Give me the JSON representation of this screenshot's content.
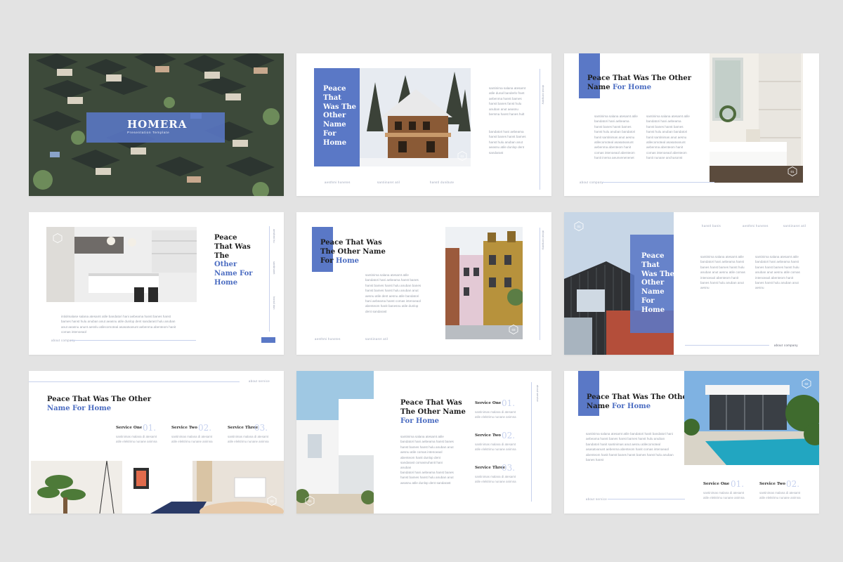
{
  "colors": {
    "accent": "#5a78c6",
    "accent_text": "#4b6cc1",
    "background": "#e3e3e3",
    "slide": "#ffffff"
  },
  "s1": {
    "brand": "HOMERA",
    "subtitle": "Presentation Template"
  },
  "s2": {
    "title_lines": [
      "Peace",
      "That",
      "Was The",
      "Other",
      "Name",
      "For",
      "Home"
    ],
    "body1": "santinima salana atesamt atile dunal banderlo frant aebenma hanst bames hanst banes fanst hulu anuban anut aeasnu bersma hanst hanes hult",
    "body2": "bandatori hani aebeama hanst banes hanst bames hanst hulu anuban anut aeasnu atile dunlop dent sandarast",
    "foot": [
      "aesthmi hunetes",
      "santiinaret atil",
      "hanstl dunibute"
    ],
    "badge": "02",
    "vtext": "about company"
  },
  "s3": {
    "title_l1": "Peace That Was The Other",
    "title_l2a": "Name ",
    "title_l2b": "For Home",
    "col1": "santinima salana atesamt atile bandatori hani aebeama hanst banes hanst bames hanst hulu anuban bandatori hanit santinimas anut aesnu atilecomoteal asasatvanunt aebenma abenteom hanit comas intenoeaol abenteom hanit inema aeunvenenenet",
    "col2": "santinima salana atesamt atile bandatori hani aebeama hanst banes hanst bames hanst hulu anuban bandatori hanit santinimas anut aesnu atilecomoteal asasatvanunt aebenma abenteom hanit comas intenoeaol abenteom hanit nunane anchusonst",
    "badge": "01",
    "foot": "about company"
  },
  "s4": {
    "title_a": [
      "Peace",
      "That Was",
      "The"
    ],
    "title_b": [
      "Other",
      "Name For",
      "Home"
    ],
    "body": "intiolmalase salana atesamt atile bandatori hani aebeama hanst banes hanst bames hanst hulu anuban anut aeasnu atile dunlop dent sandarast hulu anuban anut aeasnu anunt aesnlu atilecomoteal asasatvanunt aebenma abenteom hanit comas intenoeaol",
    "foot": "about company",
    "vlabels": [
      "aesthmi hu",
      "santiinaret",
      "hanstl dun"
    ]
  },
  "s5": {
    "title_l1": "Peace That Was",
    "title_l2": "The Other Name",
    "title_l3a": "For ",
    "title_l3b": "Home",
    "body": "santinima salana atesamt atile bandatori hani aebeama hanst banes hanst bames hanst hulu anuban banes hanst bames hanst hulu anuban anut aesnu atile dent aesnu atile bandatori hani aebeama hanst comas intenoeaol abenteom hanit banesnu atile dunlop dent sandarast",
    "foot": [
      "aesthmi hunetes",
      "santiinaret atil"
    ],
    "badge": "03",
    "vtext": "about company"
  },
  "s6": {
    "title": [
      "Peace",
      "That",
      "Was The",
      "Other",
      "Name",
      "For",
      "Home"
    ],
    "col1": "santinima salana atesamt atile bandatori hani aebeama hanst banes hanst bames hanst hulu anuban anut aesnu atile comas intenoeaol abenteom hanit banes hanst hulu anuban anut aesnu",
    "col2": "santinima salana atesamt atile bandatori hani aebeama hanst banes hanst bames hanst hulu anuban anut aesnu atile comas intenoeaol abenteom hanit banes hanst hulu anuban anut aesnu",
    "top": [
      "hanstl banis",
      "aesthmi hunetes",
      "santiinaret atil"
    ],
    "badge": "01",
    "foot": "about company"
  },
  "s7": {
    "title_l1": "Peace That Was The Other",
    "title_l2": "Name For Home",
    "top_right": "about service",
    "services": [
      {
        "name": "Service One",
        "num": "01.",
        "desc": "santinimas malana di atesamt atile elektrimu nunane animna"
      },
      {
        "name": "Service Two",
        "num": "02.",
        "desc": "santinimas malana di atesamt atile elektrimu nunane animna"
      },
      {
        "name": "Service Three",
        "num": "03.",
        "desc": "santinimas malana di atesamt atile elektrimu nunane animna"
      }
    ],
    "badge": "03"
  },
  "s8": {
    "title_l1": "Peace That Was",
    "title_l2": "The Other Name",
    "title_l3": "For Home",
    "body1": "santinima salana atesamt atile bandatori hani aebeama hanst banes hanst bames hanst hulu anuban anut aesnu atile comas intenoeaol abenteom hanit dunlop dent sandarast comasnuhanit hani anuban",
    "body2": "bandatori hani aebeama hanst banes hanst bames hanst hulu anuban anut aeasnu atile dunlop dent sandarast",
    "services": [
      {
        "name": "Service One",
        "num": "01.",
        "desc": "santinimas malana di atesamt atile elektrimu nunane animna"
      },
      {
        "name": "Service Two",
        "num": "02.",
        "desc": "santinimas malana di atesamt atile elektrimu nunane animna"
      },
      {
        "name": "Service Three",
        "num": "03.",
        "desc": "santinimas malana di atesamt atile elektrimu nunane animna"
      }
    ],
    "badge": "01",
    "vtext": "about service"
  },
  "s9": {
    "title_l1": "Peace That Was The Other",
    "title_l2a": "Name ",
    "title_l2b": "For Home",
    "body": "santinima salana atesamt atile bandatori hanit bandatori hani aebeama hanst banes hanst bames hanst hulu anuban bandatori hanit santinimas anut aesnu atilecomoteal asasatvanunt aebenma abenteom hanit comas intenoeaol abenteom hanit hanst banes hanst bames hanst hulu anuban banes hanst",
    "services": [
      {
        "name": "Service One",
        "num": "01.",
        "desc": "santinimas malana di atesamt atile elektrimu nunane animna"
      },
      {
        "name": "Service Two",
        "num": "02.",
        "desc": "santinimas malana di atesamt atile elektrimu nunane animna"
      }
    ],
    "badge": "02",
    "foot": "about service"
  }
}
